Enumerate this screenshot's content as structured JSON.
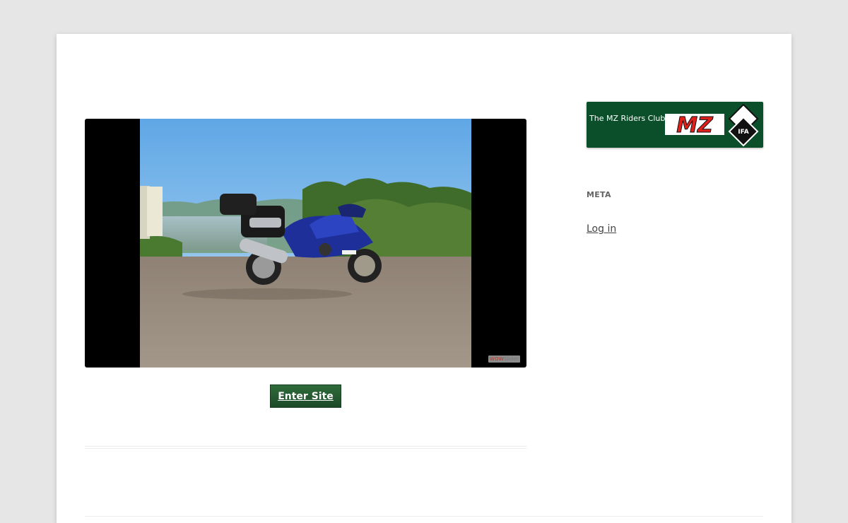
{
  "slideshow": {
    "watermark_brand": "WOW",
    "watermark_suffix": "Slider"
  },
  "main": {
    "enter_button_label": "Enter Site"
  },
  "sidebar": {
    "banner": {
      "text": "The MZ Riders Club",
      "logo_main": "MZ",
      "logo_badge": "IFA"
    },
    "meta_heading": "META",
    "login_link": "Log in"
  },
  "colors": {
    "page_background": "#e6e6e6",
    "content_background": "#ffffff",
    "banner_green": "#0b4f2a",
    "button_green": "#1d4a28",
    "logo_red": "#e0201b"
  }
}
